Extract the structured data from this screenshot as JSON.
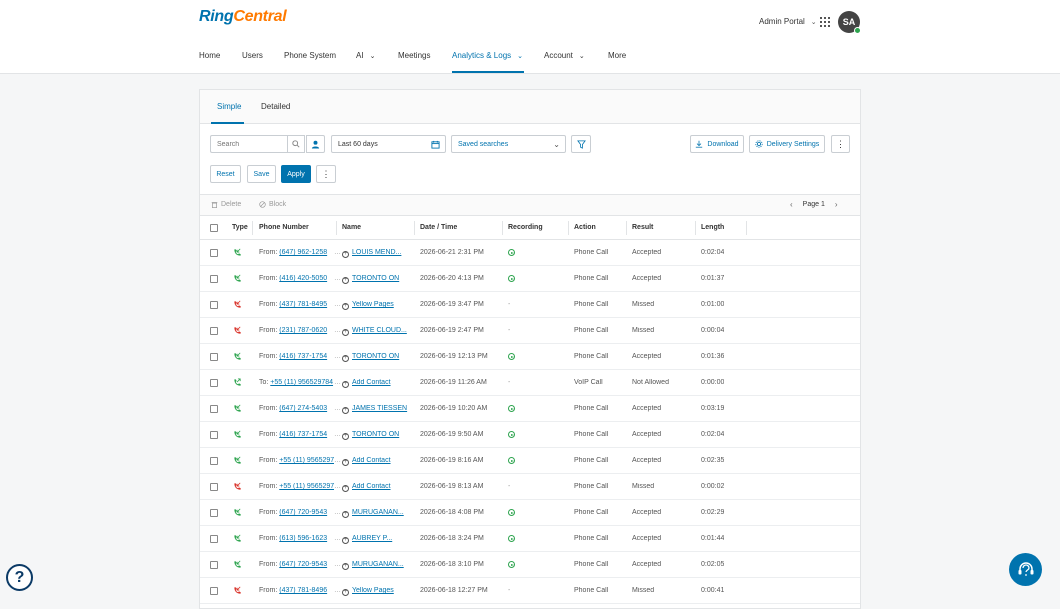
{
  "brand": {
    "part1": "Ring",
    "part2": "Central"
  },
  "header": {
    "admin_portal": "Admin Portal",
    "avatar_initials": "SA"
  },
  "nav": {
    "home": "Home",
    "users": "Users",
    "phone_system": "Phone System",
    "ai": "AI",
    "meetings": "Meetings",
    "analytics": "Analytics & Logs",
    "account": "Account",
    "more": "More"
  },
  "tabs": {
    "simple": "Simple",
    "detailed": "Detailed"
  },
  "filters": {
    "search_placeholder": "Search",
    "date_range": "Last 60 days",
    "saved_searches": "Saved searches",
    "download": "Download",
    "delivery_settings": "Delivery Settings",
    "reset": "Reset",
    "save": "Save",
    "apply": "Apply"
  },
  "toolbar": {
    "delete": "Delete",
    "block": "Block",
    "page_label": "Page",
    "page_number": "1"
  },
  "table": {
    "headers": {
      "type": "Type",
      "phone": "Phone Number",
      "name": "Name",
      "datetime": "Date / Time",
      "recording": "Recording",
      "action": "Action",
      "result": "Result",
      "length": "Length"
    },
    "rows": [
      {
        "dir": "From:",
        "phone": "(647) 962-1258",
        "name": "LOUIS MEND...",
        "add": false,
        "datetime": "2026-06-21 2:31 PM",
        "recording": true,
        "action": "Phone Call",
        "result": "Accepted",
        "length": "0:02:04",
        "status": "accepted"
      },
      {
        "dir": "From:",
        "phone": "(416) 420-5050",
        "name": "TORONTO ON",
        "add": false,
        "datetime": "2026-06-20 4:13 PM",
        "recording": true,
        "action": "Phone Call",
        "result": "Accepted",
        "length": "0:01:37",
        "status": "accepted"
      },
      {
        "dir": "From:",
        "phone": "(437) 781-8495",
        "name": "Yellow Pages",
        "add": false,
        "datetime": "2026-06-19 3:47 PM",
        "recording": false,
        "action": "Phone Call",
        "result": "Missed",
        "length": "0:01:00",
        "status": "missed"
      },
      {
        "dir": "From:",
        "phone": "(231) 787-0620",
        "name": "WHITE CLOUD...",
        "add": false,
        "datetime": "2026-06-19 2:47 PM",
        "recording": false,
        "action": "Phone Call",
        "result": "Missed",
        "length": "0:00:04",
        "status": "missed"
      },
      {
        "dir": "From:",
        "phone": "(416) 737-1754",
        "name": "TORONTO ON",
        "add": false,
        "datetime": "2026-06-19 12:13 PM",
        "recording": true,
        "action": "Phone Call",
        "result": "Accepted",
        "length": "0:01:36",
        "status": "accepted"
      },
      {
        "dir": "To:",
        "phone": "+55 (11) 956529784",
        "name": "Add Contact",
        "add": true,
        "datetime": "2026-06-19 11:26 AM",
        "recording": false,
        "action": "VoIP Call",
        "result": "Not Allowed",
        "length": "0:00:00",
        "status": "outbound"
      },
      {
        "dir": "From:",
        "phone": "(647) 274-5403",
        "name": "JAMES TIESSEN",
        "add": false,
        "datetime": "2026-06-19 10:20 AM",
        "recording": true,
        "action": "Phone Call",
        "result": "Accepted",
        "length": "0:03:19",
        "status": "accepted"
      },
      {
        "dir": "From:",
        "phone": "(416) 737-1754",
        "name": "TORONTO ON",
        "add": false,
        "datetime": "2026-06-19 9:50 AM",
        "recording": true,
        "action": "Phone Call",
        "result": "Accepted",
        "length": "0:02:04",
        "status": "accepted"
      },
      {
        "dir": "From:",
        "phone": "+55 (11) 956529784",
        "name": "Add Contact",
        "add": true,
        "datetime": "2026-06-19 8:16 AM",
        "recording": true,
        "action": "Phone Call",
        "result": "Accepted",
        "length": "0:02:35",
        "status": "accepted"
      },
      {
        "dir": "From:",
        "phone": "+55 (11) 956529784",
        "name": "Add Contact",
        "add": true,
        "datetime": "2026-06-19 8:13 AM",
        "recording": false,
        "action": "Phone Call",
        "result": "Missed",
        "length": "0:00:02",
        "status": "missed"
      },
      {
        "dir": "From:",
        "phone": "(647) 720-9543",
        "name": "MURUGANAN...",
        "add": false,
        "datetime": "2026-06-18 4:08 PM",
        "recording": true,
        "action": "Phone Call",
        "result": "Accepted",
        "length": "0:02:29",
        "status": "accepted"
      },
      {
        "dir": "From:",
        "phone": "(613) 596-1623",
        "name": "AUBREY P...",
        "add": false,
        "datetime": "2026-06-18 3:24 PM",
        "recording": true,
        "action": "Phone Call",
        "result": "Accepted",
        "length": "0:01:44",
        "status": "accepted"
      },
      {
        "dir": "From:",
        "phone": "(647) 720-9543",
        "name": "MURUGANAN...",
        "add": false,
        "datetime": "2026-06-18 3:10 PM",
        "recording": true,
        "action": "Phone Call",
        "result": "Accepted",
        "length": "0:02:05",
        "status": "accepted"
      },
      {
        "dir": "From:",
        "phone": "(437) 781-8496",
        "name": "Yellow Pages",
        "add": false,
        "datetime": "2026-06-18 12:27 PM",
        "recording": false,
        "action": "Phone Call",
        "result": "Missed",
        "length": "0:00:41",
        "status": "missed"
      }
    ]
  },
  "colors": {
    "accent": "#0073ae",
    "brand_orange": "#ff7a00",
    "accepted": "#2ea44f",
    "missed": "#d9342b",
    "fab": "#0073ae"
  }
}
